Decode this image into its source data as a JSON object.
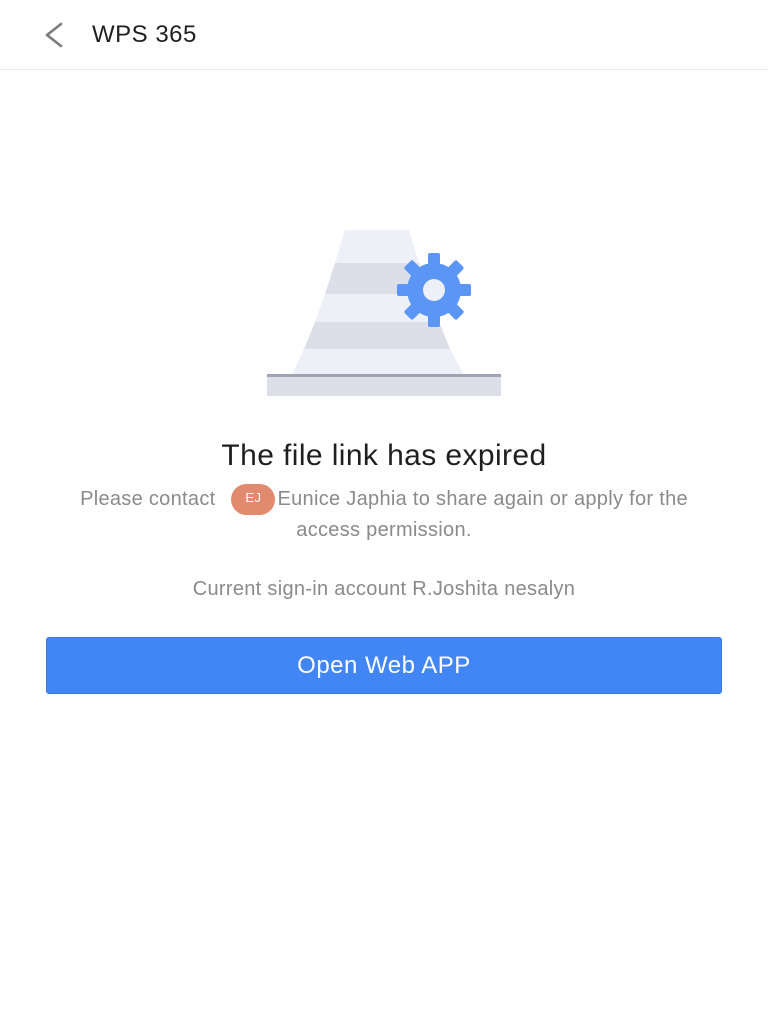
{
  "header": {
    "back_icon": "chevron-left-icon",
    "title": "WPS 365"
  },
  "illustration": {
    "icon": "expired-link-gear-illustration",
    "colors": {
      "stripe_light": "#eef0f8",
      "stripe_dark": "#dcdee8",
      "gear": "#5b95f5",
      "base": "#dcdee8"
    }
  },
  "message": {
    "title": "The file link has expired",
    "prefix": "Please contact",
    "avatar_initials": "EJ",
    "contact_name": "Eunice Japhia",
    "suffix": "to share again or apply for the access permission."
  },
  "account": {
    "label": "Current sign-in account R.Joshita nesalyn"
  },
  "actions": {
    "open_label": "Open Web APP"
  },
  "colors": {
    "accent": "#4286f5",
    "avatar_bg": "#e18a6e",
    "muted_text": "#8a8a8a"
  }
}
